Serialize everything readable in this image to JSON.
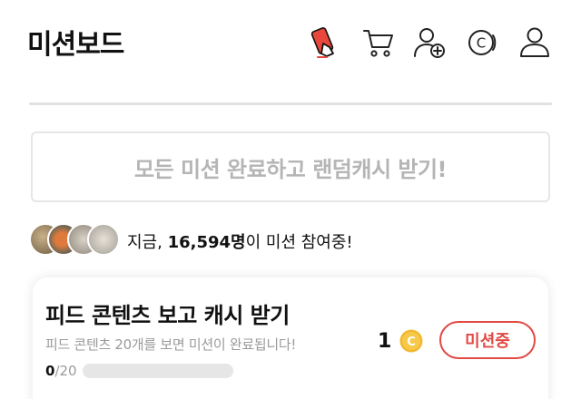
{
  "header": {
    "title": "미션보드",
    "icons": [
      "hand-phone-icon",
      "cart-icon",
      "add-user-icon",
      "cash-coin-icon",
      "user-icon"
    ]
  },
  "banner": {
    "text": "모든 미션 완료하고 랜덤캐시 받기!"
  },
  "participants": {
    "prefix": "지금, ",
    "count": "16,594명",
    "suffix": "이 미션 참여중!"
  },
  "mission": {
    "title": "피드 콘텐츠 보고 캐시 받기",
    "description": "피드 콘텐츠 20개를 보면 미션이 완료됩니다!",
    "progress_current": "0",
    "progress_total": "/20",
    "progress_fraction": 0,
    "reward_amount": "1",
    "reward_coin_letter": "C",
    "button_label": "미션중"
  },
  "colors": {
    "accent": "#e24a44",
    "coin": "#f2b830",
    "muted_text": "#b5b5b5"
  }
}
